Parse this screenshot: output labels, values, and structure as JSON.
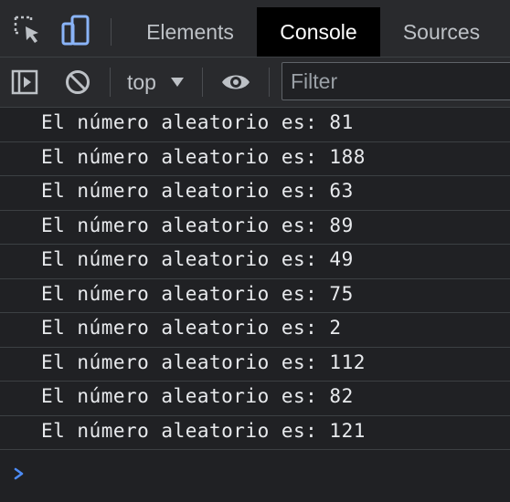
{
  "tabs": [
    {
      "label": "Elements",
      "active": false
    },
    {
      "label": "Console",
      "active": true
    },
    {
      "label": "Sources",
      "active": false
    }
  ],
  "toolbar": {
    "context_label": "top",
    "filter_placeholder": "Filter"
  },
  "console_messages": [
    "El número aleatorio es: 81",
    "El número aleatorio es: 188",
    "El número aleatorio es: 63",
    "El número aleatorio es: 89",
    "El número aleatorio es: 49",
    "El número aleatorio es: 75",
    "El número aleatorio es: 2",
    "El número aleatorio es: 112",
    "El número aleatorio es: 82",
    "El número aleatorio es: 121"
  ],
  "icons": {
    "inspect": "inspect-element-icon",
    "device": "device-toolbar-icon",
    "sidebar": "show-sidebar-icon",
    "clear": "clear-console-icon",
    "eye": "live-expression-icon",
    "prompt": "prompt-chevron-icon"
  },
  "colors": {
    "background": "#202124",
    "toolbar": "#292a2d",
    "active_tab": "#000000",
    "device_icon_blue": "#8ab4f8",
    "prompt_blue": "#4c8bf5"
  }
}
